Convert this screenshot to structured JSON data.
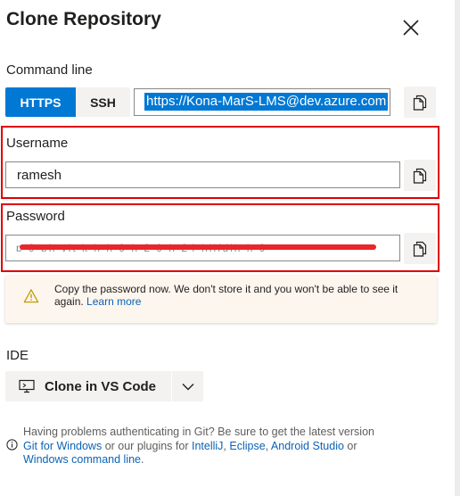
{
  "dialog": {
    "title": "Clone Repository"
  },
  "command_line": {
    "label": "Command line",
    "protocols": [
      "HTTPS",
      "SSH"
    ],
    "selected_protocol": "HTTPS",
    "url_value": "https://Kona-MarS-LMS@dev.azure.com"
  },
  "username": {
    "label": "Username",
    "value": "ramesh"
  },
  "password": {
    "label": "Password",
    "value_redacted": "p 9 ph    yjt  k   h  h   9  h  2     9   h  24 hlifdjh       h  9   "
  },
  "warning": {
    "text": "Copy the password now. We don't store it and you won't be able to see it again.",
    "learn_more": "Learn more"
  },
  "ide": {
    "label": "IDE",
    "button_label": "Clone in VS Code"
  },
  "help": {
    "text_1": "Having problems authenticating in Git? Be sure to get the latest version",
    "link_git": "Git for Windows",
    "text_2": " or our plugins for ",
    "link_intellij": "IntelliJ",
    "sep_1": ", ",
    "link_eclipse": "Eclipse",
    "sep_2": ", ",
    "link_android": "Android Studio",
    "text_3": " or",
    "link_cmd": "Windows command line",
    "text_4": "."
  },
  "colors": {
    "accent": "#0078d4",
    "highlight_box": "#e00000",
    "link": "#0b63b6",
    "warning_bg": "#fdf6ee",
    "warning_icon": "#c19c00"
  },
  "icons": {
    "close": "close-icon",
    "copy": "copy-icon",
    "warning": "warning-icon",
    "ide": "monitor-icon",
    "chevron": "chevron-down-icon",
    "info": "info-icon"
  }
}
